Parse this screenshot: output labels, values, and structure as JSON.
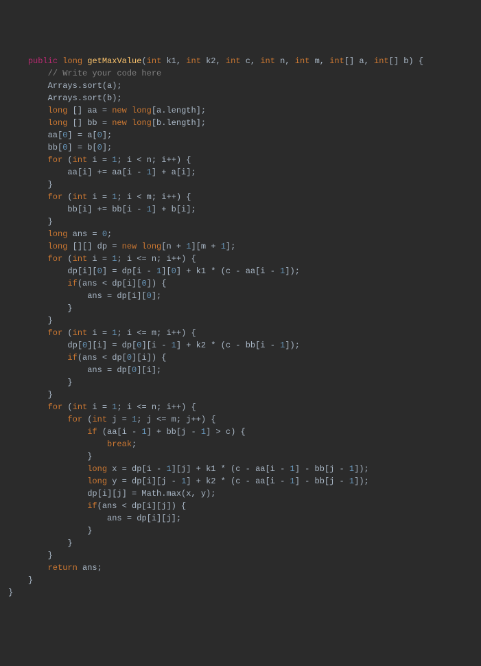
{
  "code": {
    "lines": [
      {
        "indent": 1,
        "tokens": [
          {
            "t": "public",
            "c": "kw-pub"
          },
          {
            "t": " "
          },
          {
            "t": "long",
            "c": "kw"
          },
          {
            "t": " "
          },
          {
            "t": "getMaxValue",
            "c": "fn"
          },
          {
            "t": "("
          },
          {
            "t": "int",
            "c": "kw"
          },
          {
            "t": " k1, "
          },
          {
            "t": "int",
            "c": "kw"
          },
          {
            "t": " k2, "
          },
          {
            "t": "int",
            "c": "kw"
          },
          {
            "t": " c, "
          },
          {
            "t": "int",
            "c": "kw"
          },
          {
            "t": " n, "
          },
          {
            "t": "int",
            "c": "kw"
          },
          {
            "t": " m, "
          },
          {
            "t": "int",
            "c": "kw"
          },
          {
            "t": "[] a, "
          },
          {
            "t": "int",
            "c": "kw"
          },
          {
            "t": "[] b) {"
          }
        ]
      },
      {
        "indent": 2,
        "tokens": [
          {
            "t": "// Write your code here",
            "c": "comment"
          }
        ]
      },
      {
        "indent": 2,
        "tokens": [
          {
            "t": "Arrays.sort(a);"
          }
        ]
      },
      {
        "indent": 2,
        "tokens": [
          {
            "t": "Arrays.sort(b);"
          }
        ]
      },
      {
        "indent": 2,
        "tokens": [
          {
            "t": "long",
            "c": "kw"
          },
          {
            "t": " [] aa = "
          },
          {
            "t": "new",
            "c": "kw"
          },
          {
            "t": " "
          },
          {
            "t": "long",
            "c": "kw"
          },
          {
            "t": "[a.length];"
          }
        ]
      },
      {
        "indent": 2,
        "tokens": [
          {
            "t": "long",
            "c": "kw"
          },
          {
            "t": " [] bb = "
          },
          {
            "t": "new",
            "c": "kw"
          },
          {
            "t": " "
          },
          {
            "t": "long",
            "c": "kw"
          },
          {
            "t": "[b.length];"
          }
        ]
      },
      {
        "indent": 2,
        "tokens": [
          {
            "t": "aa["
          },
          {
            "t": "0",
            "c": "num"
          },
          {
            "t": "] = a["
          },
          {
            "t": "0",
            "c": "num"
          },
          {
            "t": "];"
          }
        ]
      },
      {
        "indent": 2,
        "tokens": [
          {
            "t": "bb["
          },
          {
            "t": "0",
            "c": "num"
          },
          {
            "t": "] = b["
          },
          {
            "t": "0",
            "c": "num"
          },
          {
            "t": "];"
          }
        ]
      },
      {
        "indent": 2,
        "tokens": [
          {
            "t": "for",
            "c": "kw"
          },
          {
            "t": " ("
          },
          {
            "t": "int",
            "c": "kw"
          },
          {
            "t": " i = "
          },
          {
            "t": "1",
            "c": "num"
          },
          {
            "t": "; i < n; i++) {"
          }
        ]
      },
      {
        "indent": 3,
        "tokens": [
          {
            "t": "aa[i] += aa[i - "
          },
          {
            "t": "1",
            "c": "num"
          },
          {
            "t": "] + a[i];"
          }
        ]
      },
      {
        "indent": 2,
        "tokens": [
          {
            "t": "}"
          }
        ]
      },
      {
        "indent": 2,
        "tokens": [
          {
            "t": "for",
            "c": "kw"
          },
          {
            "t": " ("
          },
          {
            "t": "int",
            "c": "kw"
          },
          {
            "t": " i = "
          },
          {
            "t": "1",
            "c": "num"
          },
          {
            "t": "; i < m; i++) {"
          }
        ]
      },
      {
        "indent": 3,
        "tokens": [
          {
            "t": "bb[i] += bb[i - "
          },
          {
            "t": "1",
            "c": "num"
          },
          {
            "t": "] + b[i];"
          }
        ]
      },
      {
        "indent": 2,
        "tokens": [
          {
            "t": "}"
          }
        ]
      },
      {
        "indent": 2,
        "tokens": [
          {
            "t": "long",
            "c": "kw"
          },
          {
            "t": " ans = "
          },
          {
            "t": "0",
            "c": "num"
          },
          {
            "t": ";"
          }
        ]
      },
      {
        "indent": 2,
        "tokens": [
          {
            "t": "long",
            "c": "kw"
          },
          {
            "t": " [][] dp = "
          },
          {
            "t": "new",
            "c": "kw"
          },
          {
            "t": " "
          },
          {
            "t": "long",
            "c": "kw"
          },
          {
            "t": "[n + "
          },
          {
            "t": "1",
            "c": "num"
          },
          {
            "t": "][m + "
          },
          {
            "t": "1",
            "c": "num"
          },
          {
            "t": "];"
          }
        ]
      },
      {
        "indent": 2,
        "tokens": [
          {
            "t": "for",
            "c": "kw"
          },
          {
            "t": " ("
          },
          {
            "t": "int",
            "c": "kw"
          },
          {
            "t": " i = "
          },
          {
            "t": "1",
            "c": "num"
          },
          {
            "t": "; i <= n; i++) {"
          }
        ]
      },
      {
        "indent": 3,
        "tokens": [
          {
            "t": "dp[i]["
          },
          {
            "t": "0",
            "c": "num"
          },
          {
            "t": "] = dp[i - "
          },
          {
            "t": "1",
            "c": "num"
          },
          {
            "t": "]["
          },
          {
            "t": "0",
            "c": "num"
          },
          {
            "t": "] + k1 * (c - aa[i - "
          },
          {
            "t": "1",
            "c": "num"
          },
          {
            "t": "]);"
          }
        ]
      },
      {
        "indent": 3,
        "tokens": [
          {
            "t": "if",
            "c": "kw"
          },
          {
            "t": "(ans < dp[i]["
          },
          {
            "t": "0",
            "c": "num"
          },
          {
            "t": "]) {"
          }
        ]
      },
      {
        "indent": 4,
        "tokens": [
          {
            "t": "ans = dp[i]["
          },
          {
            "t": "0",
            "c": "num"
          },
          {
            "t": "];"
          }
        ]
      },
      {
        "indent": 3,
        "tokens": [
          {
            "t": "}"
          }
        ]
      },
      {
        "indent": 2,
        "tokens": [
          {
            "t": "}"
          }
        ]
      },
      {
        "indent": 2,
        "tokens": [
          {
            "t": "for",
            "c": "kw"
          },
          {
            "t": " ("
          },
          {
            "t": "int",
            "c": "kw"
          },
          {
            "t": " i = "
          },
          {
            "t": "1",
            "c": "num"
          },
          {
            "t": "; i <= m; i++) {"
          }
        ]
      },
      {
        "indent": 3,
        "tokens": [
          {
            "t": "dp["
          },
          {
            "t": "0",
            "c": "num"
          },
          {
            "t": "][i] = dp["
          },
          {
            "t": "0",
            "c": "num"
          },
          {
            "t": "][i - "
          },
          {
            "t": "1",
            "c": "num"
          },
          {
            "t": "] + k2 * (c - bb[i - "
          },
          {
            "t": "1",
            "c": "num"
          },
          {
            "t": "]);"
          }
        ]
      },
      {
        "indent": 3,
        "tokens": [
          {
            "t": "if",
            "c": "kw"
          },
          {
            "t": "(ans < dp["
          },
          {
            "t": "0",
            "c": "num"
          },
          {
            "t": "][i]) {"
          }
        ]
      },
      {
        "indent": 4,
        "tokens": [
          {
            "t": "ans = dp["
          },
          {
            "t": "0",
            "c": "num"
          },
          {
            "t": "][i];"
          }
        ]
      },
      {
        "indent": 3,
        "tokens": [
          {
            "t": "}"
          }
        ]
      },
      {
        "indent": 2,
        "tokens": [
          {
            "t": "}"
          }
        ]
      },
      {
        "indent": 2,
        "tokens": [
          {
            "t": "for",
            "c": "kw"
          },
          {
            "t": " ("
          },
          {
            "t": "int",
            "c": "kw"
          },
          {
            "t": " i = "
          },
          {
            "t": "1",
            "c": "num"
          },
          {
            "t": "; i <= n; i++) {"
          }
        ]
      },
      {
        "indent": 3,
        "tokens": [
          {
            "t": "for",
            "c": "kw"
          },
          {
            "t": " ("
          },
          {
            "t": "int",
            "c": "kw"
          },
          {
            "t": " j = "
          },
          {
            "t": "1",
            "c": "num"
          },
          {
            "t": "; j <= m; j++) {"
          }
        ]
      },
      {
        "indent": 4,
        "tokens": [
          {
            "t": "if",
            "c": "kw"
          },
          {
            "t": " (aa[i - "
          },
          {
            "t": "1",
            "c": "num"
          },
          {
            "t": "] + bb[j - "
          },
          {
            "t": "1",
            "c": "num"
          },
          {
            "t": "] > c) {"
          }
        ]
      },
      {
        "indent": 5,
        "tokens": [
          {
            "t": "break",
            "c": "kw"
          },
          {
            "t": ";"
          }
        ]
      },
      {
        "indent": 4,
        "tokens": [
          {
            "t": "}"
          }
        ]
      },
      {
        "indent": 4,
        "tokens": [
          {
            "t": "long",
            "c": "kw"
          },
          {
            "t": " x = dp[i - "
          },
          {
            "t": "1",
            "c": "num"
          },
          {
            "t": "][j] + k1 * (c - aa[i - "
          },
          {
            "t": "1",
            "c": "num"
          },
          {
            "t": "] - bb[j - "
          },
          {
            "t": "1",
            "c": "num"
          },
          {
            "t": "]);"
          }
        ]
      },
      {
        "indent": 4,
        "tokens": [
          {
            "t": "long",
            "c": "kw"
          },
          {
            "t": " y = dp[i][j - "
          },
          {
            "t": "1",
            "c": "num"
          },
          {
            "t": "] + k2 * (c - aa[i - "
          },
          {
            "t": "1",
            "c": "num"
          },
          {
            "t": "] - bb[j - "
          },
          {
            "t": "1",
            "c": "num"
          },
          {
            "t": "]);"
          }
        ]
      },
      {
        "indent": 4,
        "tokens": [
          {
            "t": "dp[i][j] = Math.max(x, y);"
          }
        ]
      },
      {
        "indent": 4,
        "tokens": [
          {
            "t": "if",
            "c": "kw"
          },
          {
            "t": "(ans < dp[i][j]) {"
          }
        ]
      },
      {
        "indent": 5,
        "tokens": [
          {
            "t": "ans = dp[i][j];"
          }
        ]
      },
      {
        "indent": 4,
        "tokens": [
          {
            "t": "}"
          }
        ]
      },
      {
        "indent": 3,
        "tokens": [
          {
            "t": "}"
          }
        ]
      },
      {
        "indent": 2,
        "tokens": [
          {
            "t": "}"
          }
        ]
      },
      {
        "indent": 2,
        "tokens": [
          {
            "t": "return",
            "c": "kw"
          },
          {
            "t": " ans;"
          }
        ]
      },
      {
        "indent": 1,
        "tokens": [
          {
            "t": "}"
          }
        ]
      },
      {
        "indent": 0,
        "tokens": [
          {
            "t": "}"
          }
        ]
      }
    ]
  }
}
